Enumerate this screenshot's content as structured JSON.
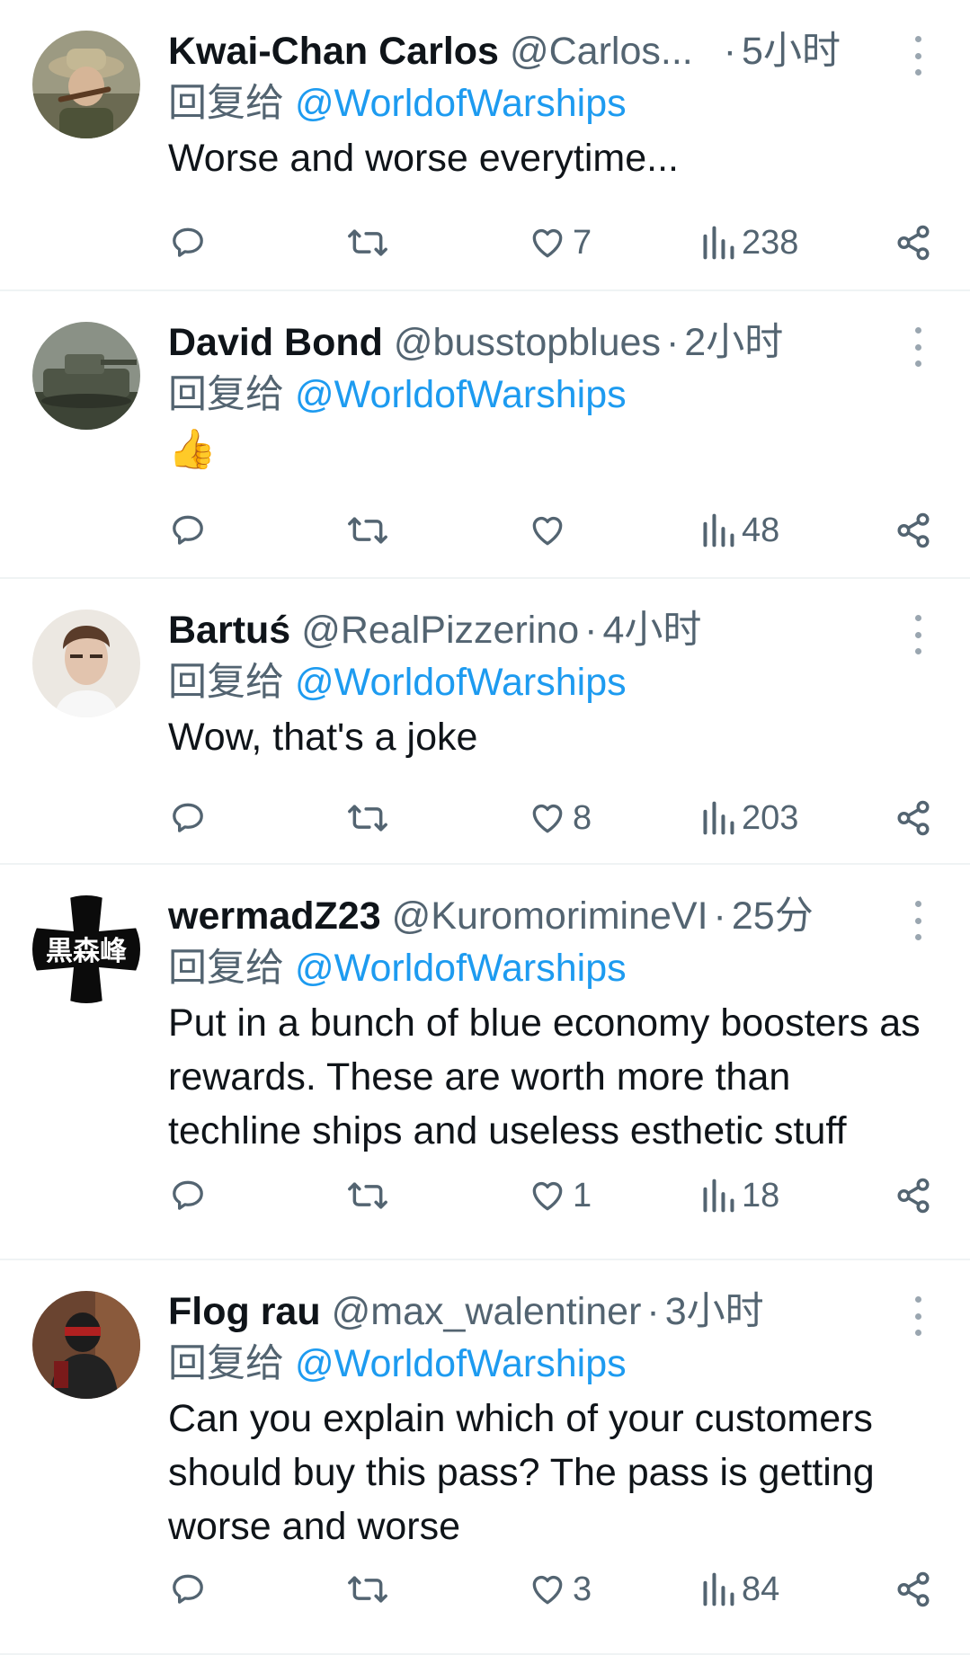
{
  "reply_prefix": "回复给",
  "colors": {
    "accent": "#1d9bf0",
    "secondary_text": "#536471",
    "primary_text": "#0f1419",
    "divider": "#eff3f4"
  },
  "icons": {
    "more": "more-vertical-icon",
    "reply": "reply-bubble-icon",
    "retweet": "retweet-icon",
    "like": "heart-icon",
    "views": "views-bar-icon",
    "share": "share-icon"
  },
  "tweets": [
    {
      "name": "Kwai-Chan Carlos",
      "handle": "@Carlos...",
      "sep": "·",
      "time": "5小时",
      "mention": "@WorldofWarships",
      "text": "Worse and worse everytime...",
      "likes": "7",
      "views": "238"
    },
    {
      "name": "David Bond",
      "handle": "@busstopblues",
      "sep": "·",
      "time": "2小时",
      "mention": "@WorldofWarships",
      "text": "👍",
      "likes": "",
      "views": "48"
    },
    {
      "name": "Bartuś",
      "handle": "@RealPizzerino",
      "sep": "·",
      "time": "4小时",
      "mention": "@WorldofWarships",
      "text": "Wow, that's a joke",
      "likes": "8",
      "views": "203"
    },
    {
      "name": "wermadZ23",
      "handle": "@KuromorimineVI",
      "sep": "·",
      "time": "25分",
      "mention": "@WorldofWarships",
      "text": "Put in a bunch of blue economy boosters as rewards. These are worth more than techline ships and useless esthetic stuff",
      "likes": "1",
      "views": "18",
      "avatar_text": "黒森峰"
    },
    {
      "name": "Flog rau",
      "handle": "@max_walentiner",
      "sep": "·",
      "time": "3小时",
      "mention": "@WorldofWarships",
      "text": "Can you explain which of your customers should buy this pass? The pass is getting worse and worse",
      "likes": "3",
      "views": "84"
    }
  ]
}
